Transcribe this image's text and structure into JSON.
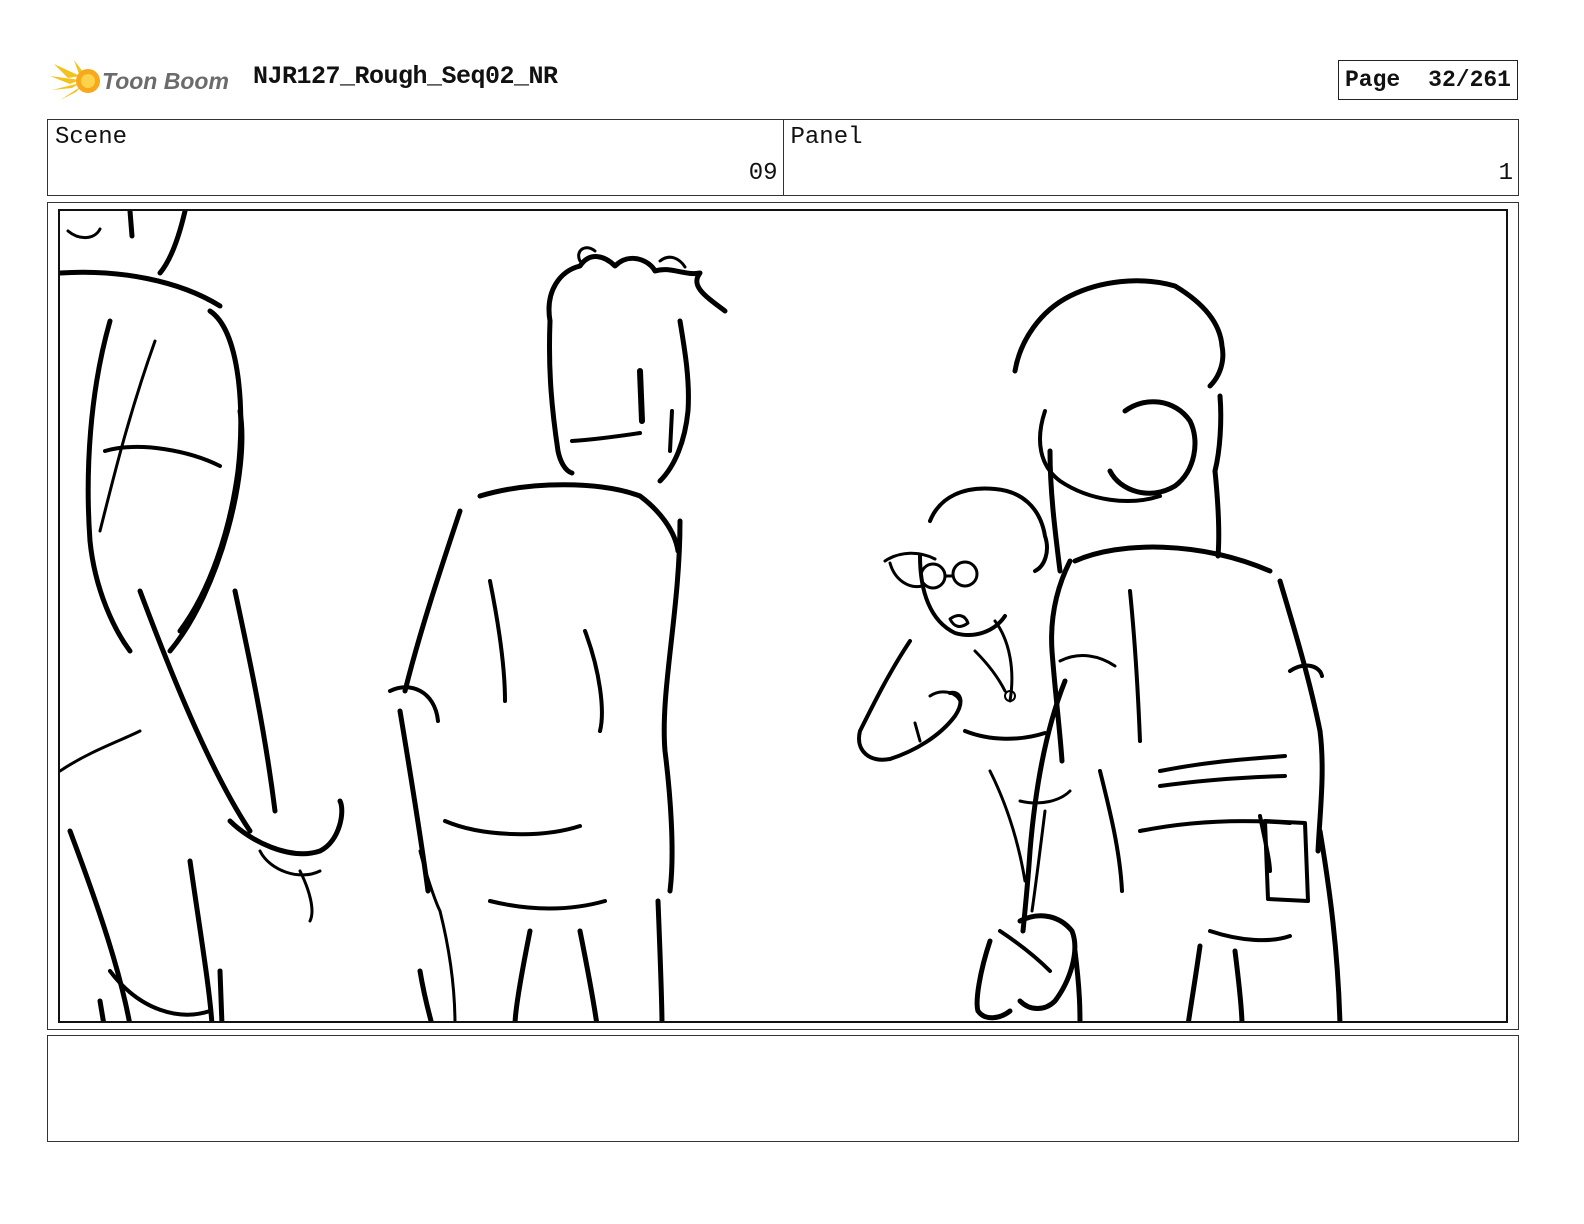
{
  "header": {
    "logo_text": "Toon Boom",
    "project_title": "NJR127_Rough_Seq02_NR",
    "page_label": "Page",
    "page_number": "32/261"
  },
  "info": {
    "scene_label": "Scene",
    "scene_value": "09",
    "panel_label": "Panel",
    "panel_value": "1"
  },
  "notes": {
    "text": ""
  }
}
